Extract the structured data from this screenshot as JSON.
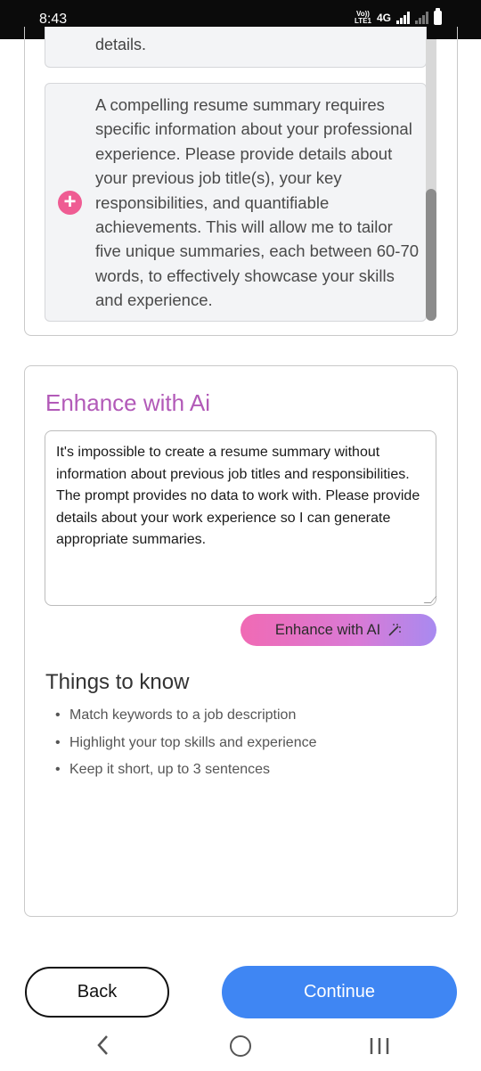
{
  "status_bar": {
    "time": "8:43",
    "volte_top": "Vo))",
    "volte_bottom": "LTE1",
    "network": "4G"
  },
  "previous_item": {
    "text_tail": "details."
  },
  "suggestion": {
    "text": "A compelling resume summary requires specific information about your professional experience. Please provide details about your previous job title(s), your key responsibilities, and quantifiable achievements. This will allow me to tailor five unique summaries, each between 60-70 words, to effectively showcase your skills and experience.",
    "add_icon": "plus-icon"
  },
  "enhance": {
    "title": "Enhance with Ai",
    "textarea_value": "It's impossible to create a resume summary without information about previous job titles and responsibilities.  The prompt provides no data to work with.  Please provide details about your work experience so I can generate appropriate summaries.",
    "button_label": "Enhance with AI",
    "button_icon": "magic-wand-icon"
  },
  "things_to_know": {
    "title": "Things to know",
    "items": [
      "Match keywords to a job description",
      "Highlight your top skills and experience",
      "Keep it short, up to 3 sentences"
    ]
  },
  "footer": {
    "back_label": "Back",
    "continue_label": "Continue"
  },
  "colors": {
    "accent_blue": "#3f86f3",
    "enhance_title": "#b25ab8",
    "plus_pink": "#ef5c93"
  }
}
